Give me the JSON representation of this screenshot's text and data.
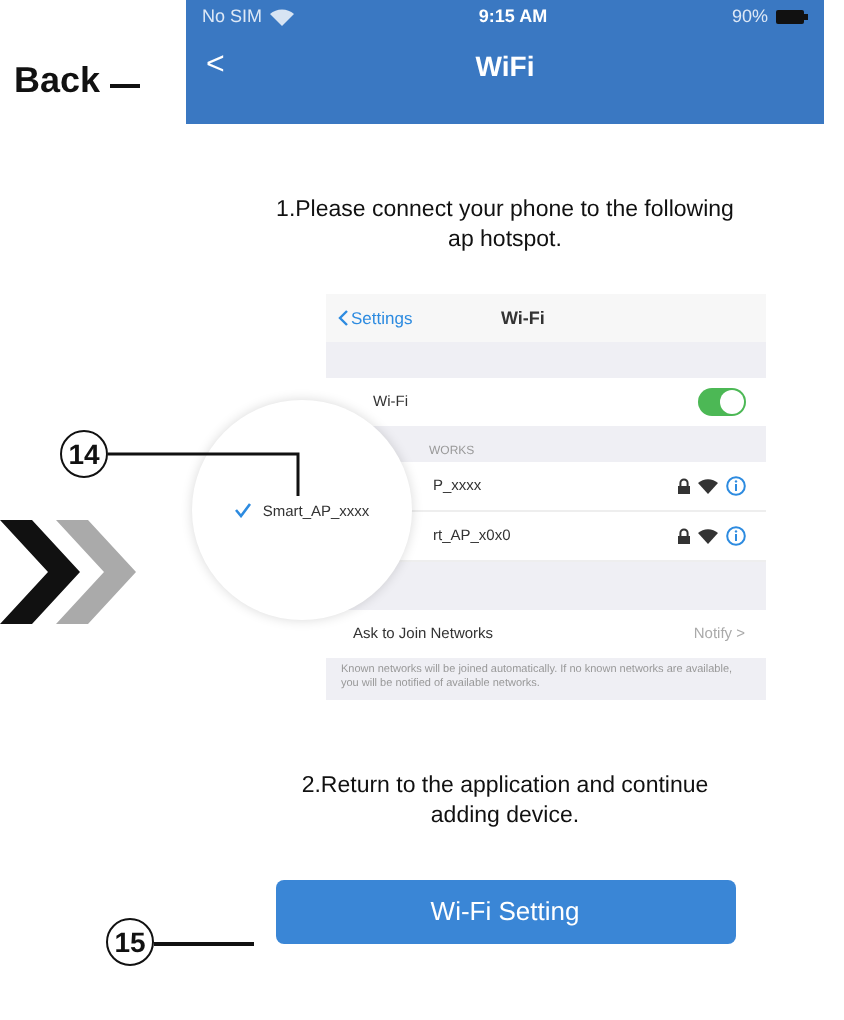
{
  "status_bar": {
    "carrier": "No SIM",
    "time": "9:15 AM",
    "battery": "90%"
  },
  "nav": {
    "back_label": "Back",
    "back_icon": "<",
    "title": "WiFi"
  },
  "step_1": "1.Please connect your phone to the following ap hotspot.",
  "settings_screen": {
    "back": "Settings",
    "title": "Wi-Fi",
    "wifi_label": "Wi-Fi",
    "wifi_on": true,
    "section_header": "WORKS",
    "networks": [
      "P_xxxx",
      "rt_AP_x0x0"
    ],
    "ask_label": "Ask to Join Networks",
    "ask_value": "Notify",
    "ask_arrow": ">",
    "footnote": "Known networks will be joined automatically. If no known networks are available, you will be notified of available networks."
  },
  "magnifier": {
    "network": "Smart_AP_xxxx",
    "selected": true
  },
  "callouts": [
    "14",
    "15"
  ],
  "step_2": "2.Return to the application and continue adding device.",
  "button": "Wi-Fi Setting"
}
